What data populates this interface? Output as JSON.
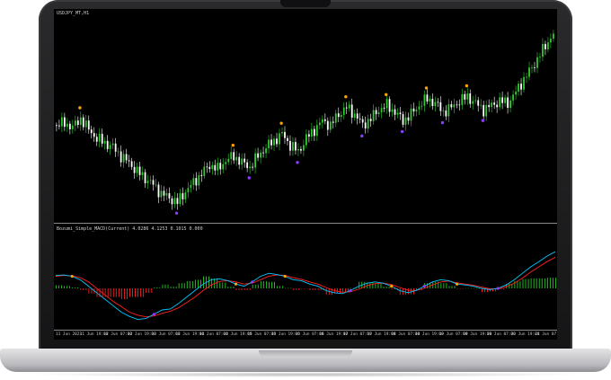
{
  "chart_window": {
    "symbol_label": "USDJPY_MT,H1",
    "indicator_label": "Bozumi_Simple_MACD(Current)",
    "indicator_values": [
      "4.0286",
      "4.1253",
      "0.1015",
      "0.000"
    ]
  },
  "time_axis": {
    "labels": [
      "11 Jun 2023",
      "11 Jun 19:00",
      "12 Jun 07:00",
      "12 Jun 19:00",
      "13 Jun 07:00",
      "13 Jun 19:00",
      "14 Jun 07:00",
      "14 Jun 19:00",
      "15 Jun 07:00",
      "15 Jun 19:00",
      "16 Jun 07:00",
      "16 Jun 19:00",
      "17 Jun 07:00",
      "17 Jun 19:00",
      "18 Jun 07:00",
      "18 Jun 19:00",
      "19 Jun 07:00",
      "19 Jun 19:00",
      "20 Jun 07:00",
      "20 Jun 19:00",
      "21 Jun 07:00"
    ]
  },
  "colors": {
    "bull_candle": "#2ecc2e",
    "bear_candle": "#ffffff",
    "macd_line": "#00c8ff",
    "signal_line": "#ff2020",
    "hist_positive": "#22cc22",
    "hist_negative": "#ff2020",
    "dot_orange": "#ffa500",
    "dot_purple": "#8a3cff"
  },
  "chart_data": {
    "type": "line",
    "price_series": {
      "closes": [
        146.3,
        146.4,
        146.2,
        146.6,
        146.1,
        145.7,
        145.5,
        145.3,
        144.9,
        144.6,
        144.2,
        143.9,
        143.6,
        143.2,
        143.0,
        142.8,
        143.3,
        143.7,
        144.1,
        144.5,
        144.3,
        144.7,
        144.9,
        144.6,
        144.4,
        144.9,
        145.3,
        145.6,
        145.9,
        145.4,
        145.1,
        145.7,
        146.1,
        146.5,
        146.3,
        146.8,
        147.1,
        146.8,
        146.3,
        146.6,
        147.0,
        147.2,
        146.9,
        146.5,
        146.8,
        147.2,
        147.5,
        147.3,
        146.9,
        147.1,
        147.4,
        147.6,
        147.3,
        147.0,
        147.2,
        147.4,
        147.3,
        147.8,
        148.4,
        148.9,
        149.5,
        150.1,
        150.6
      ]
    },
    "oscillator": {
      "macd": [
        0.3,
        0.31,
        0.28,
        0.2,
        0.05,
        -0.1,
        -0.25,
        -0.4,
        -0.55,
        -0.65,
        -0.72,
        -0.7,
        -0.6,
        -0.5,
        -0.48,
        -0.35,
        -0.2,
        -0.05,
        0.1,
        0.2,
        0.22,
        0.18,
        0.1,
        0.05,
        0.15,
        0.28,
        0.35,
        0.32,
        0.28,
        0.2,
        0.18,
        0.1,
        0.05,
        -0.05,
        -0.1,
        -0.12,
        -0.05,
        0.05,
        0.12,
        0.15,
        0.12,
        0.05,
        -0.05,
        -0.1,
        -0.05,
        0.05,
        0.15,
        0.2,
        0.18,
        0.1,
        0.08,
        0.05,
        0.0,
        -0.03,
        0.0,
        0.08,
        0.2,
        0.35,
        0.5,
        0.62,
        0.75,
        0.85
      ],
      "signal": [
        0.28,
        0.3,
        0.29,
        0.25,
        0.15,
        0.0,
        -0.15,
        -0.3,
        -0.42,
        -0.55,
        -0.62,
        -0.66,
        -0.64,
        -0.58,
        -0.53,
        -0.45,
        -0.33,
        -0.2,
        -0.05,
        0.08,
        0.16,
        0.18,
        0.15,
        0.1,
        0.12,
        0.2,
        0.28,
        0.31,
        0.3,
        0.25,
        0.21,
        0.15,
        0.1,
        0.02,
        -0.05,
        -0.09,
        -0.08,
        -0.02,
        0.06,
        0.11,
        0.12,
        0.09,
        0.02,
        -0.04,
        -0.05,
        0.0,
        0.08,
        0.15,
        0.17,
        0.13,
        0.1,
        0.07,
        0.03,
        -0.01,
        -0.01,
        0.04,
        0.12,
        0.24,
        0.38,
        0.5,
        0.62,
        0.72
      ]
    }
  }
}
